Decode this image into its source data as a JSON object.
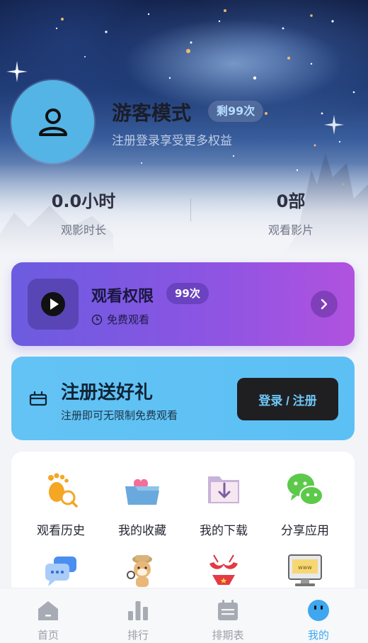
{
  "profile": {
    "name": "游客模式",
    "remaining_badge": "剩99次",
    "subtitle": "注册登录享受更多权益"
  },
  "stats": [
    {
      "value": "0.0小时",
      "label": "观影时长"
    },
    {
      "value": "0部",
      "label": "观看影片"
    }
  ],
  "watch_card": {
    "title": "观看权限",
    "badge": "99次",
    "subtitle": "免费观看"
  },
  "register_card": {
    "title": "注册送好礼",
    "subtitle": "注册即可无限制免费观看",
    "button": "登录 / 注册"
  },
  "grid": {
    "items": [
      {
        "label": "观看历史",
        "icon": "footprint-icon"
      },
      {
        "label": "我的收藏",
        "icon": "heart-box-icon"
      },
      {
        "label": "我的下载",
        "icon": "download-folder-icon"
      },
      {
        "label": "分享应用",
        "icon": "wechat-icon"
      },
      {
        "label": "",
        "icon": "chat-bubble-icon"
      },
      {
        "label": "",
        "icon": "shiba-detective-icon"
      },
      {
        "label": "",
        "icon": "bikini-icon"
      },
      {
        "label": "",
        "icon": "web-monitor-icon"
      }
    ]
  },
  "nav": {
    "items": [
      {
        "label": "首页",
        "icon": "home-icon"
      },
      {
        "label": "排行",
        "icon": "ranking-icon"
      },
      {
        "label": "排期表",
        "icon": "calendar-icon"
      },
      {
        "label": "我的",
        "icon": "smiley-icon"
      }
    ],
    "active_index": 3
  },
  "colors": {
    "accent_blue": "#3ea7f0",
    "purple_start": "#6b5ce0",
    "purple_end": "#b152e0",
    "register_bg": "#5cc0f5",
    "button_dark": "#1f1f22"
  }
}
